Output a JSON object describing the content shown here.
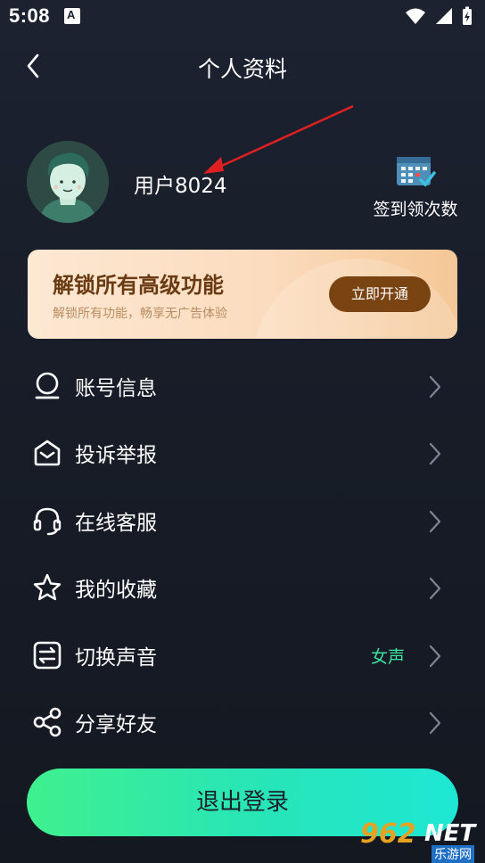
{
  "status_bar": {
    "time": "5:08",
    "notification_glyph": "A"
  },
  "header": {
    "title": "个人资料"
  },
  "profile": {
    "username": "用户8024",
    "checkin_label": "签到领次数"
  },
  "banner": {
    "title": "解锁所有高级功能",
    "subtitle": "解锁所有功能，畅享无广告体验",
    "button": "立即开通"
  },
  "menu": [
    {
      "icon": "user-icon",
      "label": "账号信息",
      "value": ""
    },
    {
      "icon": "mail-icon",
      "label": "投诉举报",
      "value": ""
    },
    {
      "icon": "headset-icon",
      "label": "在线客服",
      "value": ""
    },
    {
      "icon": "star-icon",
      "label": "我的收藏",
      "value": ""
    },
    {
      "icon": "switch-icon",
      "label": "切换声音",
      "value": "女声"
    },
    {
      "icon": "share-icon",
      "label": "分享好友",
      "value": ""
    }
  ],
  "logout": {
    "label": "退出登录"
  },
  "watermark": {
    "number": "962",
    "net": "NET",
    "sub": "乐游网"
  },
  "colors": {
    "accent_green": "#3ee3a0",
    "banner_button": "#7a4412",
    "logout_start": "#3ff08e",
    "logout_end": "#1ee7d4"
  }
}
